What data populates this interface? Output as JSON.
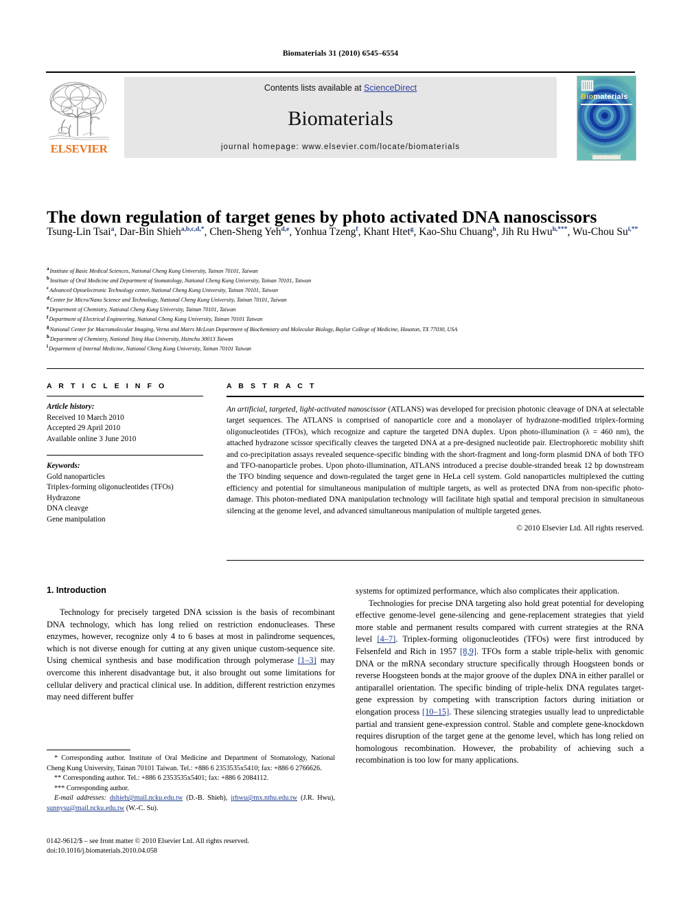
{
  "running_head": "Biomaterials 31 (2010) 6545–6554",
  "masthead": {
    "contents_prefix": "Contents lists available at ",
    "sciencedirect": "ScienceDirect",
    "journal_title": "Biomaterials",
    "homepage": "journal homepage: www.elsevier.com/locate/biomaterials",
    "publisher_name": "ELSEVIER",
    "publisher_color": "#E87722",
    "link_color": "#2c3e9e",
    "band_color": "#e6e6e6",
    "cover": {
      "title_first": "Bio",
      "title_rest": "materials",
      "footer_text": "ISSN 0142-9612  Volume 31",
      "bg_color": "#48a9a6",
      "ring_color": "#123a9c"
    }
  },
  "article": {
    "title": "The down regulation of target genes by photo activated DNA nanoscissors",
    "authors": [
      {
        "name": "Tsung-Lin Tsai",
        "marks": "a",
        "sep": ", "
      },
      {
        "name": "Dar-Bin Shieh",
        "marks": "a,b,c,d,*",
        "sep": ", "
      },
      {
        "name": "Chen-Sheng Yeh",
        "marks": "d,e",
        "sep": ", "
      },
      {
        "name": "Yonhua Tzeng",
        "marks": "f",
        "sep": ", "
      },
      {
        "name": "Khant Htet",
        "marks": "g",
        "sep": ", "
      },
      {
        "name": "Kao-Shu Chuang",
        "marks": "h",
        "sep": ", "
      },
      {
        "name": "Jih Ru Hwu",
        "marks": "h,***",
        "sep": ", "
      },
      {
        "name": "Wu-Chou Su",
        "marks": "i,**",
        "sep": ""
      }
    ],
    "affiliations": [
      {
        "mark": "a",
        "text": "Institute of Basic Medical Sciences, National Cheng Kung University, Tainan 70101, Taiwan"
      },
      {
        "mark": "b",
        "text": "Institute of Oral Medicine and Department of Stomatology, National Cheng Kung University, Tainan 70101, Taiwan"
      },
      {
        "mark": "c",
        "text": "Advanced Optoelectronic Technology center, National Cheng Kung University, Tainan 70101, Taiwan"
      },
      {
        "mark": "d",
        "text": "Center for Micro/Nano Science and Technology, National Cheng Kung University, Tainan 70101, Taiwan"
      },
      {
        "mark": "e",
        "text": "Department of Chemistry, National Cheng Kung University, Tainan 70101, Taiwan"
      },
      {
        "mark": "f",
        "text": "Department of Electrical Engineering, National Cheng Kung University, Tainan 70101 Taiwan"
      },
      {
        "mark": "g",
        "text": "National Center for Macromolecular Imaging, Verna and Marrs McLean Department of Biochemistry and Molecular Biology, Baylor College of Medicine, Houston, TX 77030, USA"
      },
      {
        "mark": "h",
        "text": "Department of Chemistry, National Tsing Hua University, Hsinchu 30013 Taiwan"
      },
      {
        "mark": "i",
        "text": "Department of Internal Medicine, National Cheng Kung University, Tainan 70101 Taiwan"
      }
    ]
  },
  "article_info": {
    "heading": "A R T I C L E  I N F O",
    "history_label": "Article history:",
    "history": [
      "Received 10 March 2010",
      "Accepted 29 April 2010",
      "Available online 3 June 2010"
    ],
    "keywords_label": "Keywords:",
    "keywords": [
      "Gold nanoparticles",
      "Triplex-forming oligonucleotides (TFOs)",
      "Hydrazone",
      "DNA cleavge",
      "Gene manipulation"
    ]
  },
  "abstract": {
    "heading": "A B S T R A C T",
    "lead_italic": "An artificial, targeted, light-activated nanoscissor",
    "body": " (ATLANS) was developed for precision photonic cleavage of DNA at selectable target sequences. The ATLANS is comprised of nanoparticle core and a monolayer of hydrazone-modified triplex-forming oligonucleotides (TFOs), which recognize and capture the targeted DNA duplex. Upon photo-illumination (λ = 460 nm), the attached hydrazone scissor specifically cleaves the targeted DNA at a pre-designed nucleotide pair. Electrophoretic mobility shift and co-precipitation assays revealed sequence-specific binding with the short-fragment and long-form plasmid DNA of both TFO and TFO-nanoparticle probes. Upon photo-illumination, ATLANS introduced a precise double-stranded break 12 bp downstream the TFO binding sequence and down-regulated the target gene in HeLa cell system. Gold nanoparticles multiplexed the cutting efficiency and potential for simultaneous manipulation of multiple targets, as well as protected DNA from non-specific photo-damage. This photon-mediated DNA manipulation technology will facilitate high spatial and temporal precision in simultaneous silencing at the genome level, and advanced simultaneous manipulation of multiple targeted genes.",
    "copyright": "© 2010 Elsevier Ltd. All rights reserved."
  },
  "intro": {
    "heading": "1.  Introduction",
    "left_para_1": "Technology for precisely targeted DNA scission is the basis of recombinant DNA technology, which has long relied on restriction endonucleases. These enzymes, however, recognize only 4 to 6 bases at most in palindrome sequences, which is not diverse enough for cutting at any given unique custom-sequence site. Using chemical synthesis and base modification through polymerase ",
    "left_ref_1": "[1–3]",
    "left_para_1b": " may overcome this inherent disadvantage but, it also brought out some limitations for cellular delivery and practical clinical use. In addition, different restriction enzymes may need different buffer",
    "right_para_1": "systems for optimized performance, which also complicates their application.",
    "right_para_2a": "Technologies for precise DNA targeting also hold great potential for developing effective genome-level gene-silencing and gene-replacement strategies that yield more stable and permanent results compared with current strategies at the RNA level ",
    "right_ref_1": "[4–7]",
    "right_para_2b": ". Triplex-forming oligonucleotides (TFOs) were first introduced by Felsenfeld and Rich in 1957 ",
    "right_ref_2": "[8,9]",
    "right_para_2c": ". TFOs form a stable triple-helix with genomic DNA or the mRNA secondary structure specifically through Hoogsteen bonds or reverse Hoogsteen bonds at the major groove of the duplex DNA in either parallel or antiparallel orientation. The specific binding of triple-helix DNA regulates target-gene expression by competing with transcription factors during initiation or elongation process ",
    "right_ref_3": "[10–15]",
    "right_para_2d": ". These silencing strategies usually lead to unpredictable partial and transient gene-expression control. Stable and complete gene-knockdown requires disruption of the target gene at the genome level, which has long relied on homologous recombination. However, the probability of achieving such a recombination is too low for many applications."
  },
  "footnotes": {
    "corresponding_1": "* Corresponding author. Institute of Oral Medicine and Department of Stomatology, National Cheng Kung University, Tainan 70101 Taiwan. Tel.: +886 6 2353535x5410; fax: +886 6 2766626.",
    "corresponding_2": "** Corresponding author. Tel.: +886 6 2353535x5401; fax: +886 6 2084112.",
    "corresponding_3": "*** Corresponding author.",
    "email_label": "E-mail addresses:",
    "email_1": "dshieh@mail.ncku.edu.tw",
    "email_1_owner": " (D.-B. Shieh), ",
    "email_2": "jrhwu@mx.nthu.edu.tw",
    "email_2_owner": " (J.R. Hwu), ",
    "email_3": "sunnysu@mail.ncku.edu.tw",
    "email_3_owner": " (W.-C. Su)."
  },
  "imprint": {
    "issn_line": "0142-9612/$ – see front matter © 2010 Elsevier Ltd. All rights reserved.",
    "doi_line": "doi:10.1016/j.biomaterials.2010.04.058"
  }
}
